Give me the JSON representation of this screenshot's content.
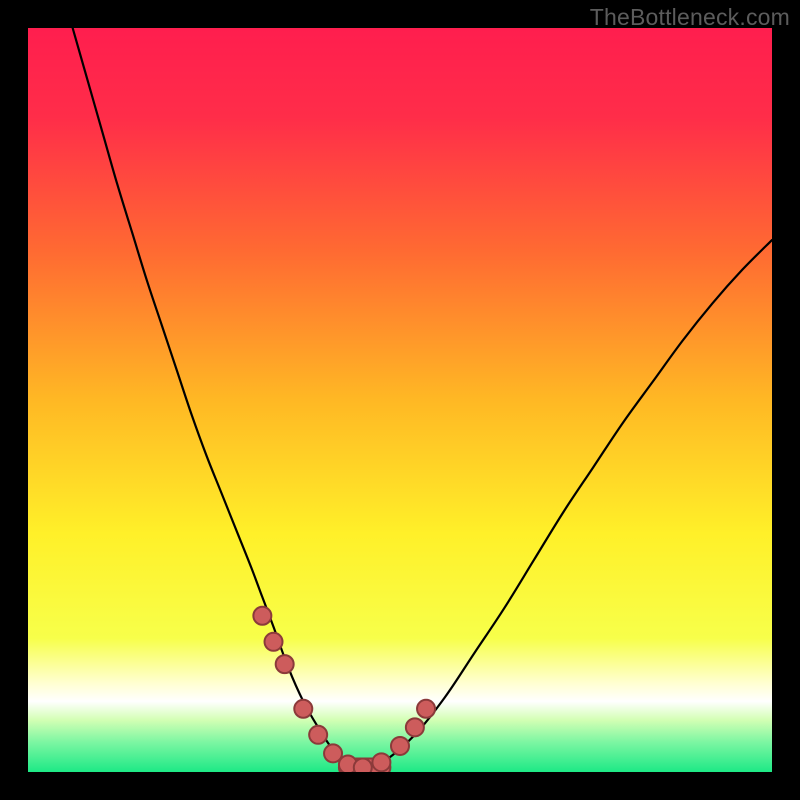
{
  "watermark": {
    "text": "TheBottleneck.com"
  },
  "chart_data": {
    "type": "line",
    "title": "",
    "xlabel": "",
    "ylabel": "",
    "xlim": [
      0,
      100
    ],
    "ylim": [
      0,
      100
    ],
    "grid": false,
    "legend": false,
    "gradient_stops": [
      {
        "offset": 0.0,
        "color": "#ff1e4e"
      },
      {
        "offset": 0.12,
        "color": "#ff2d49"
      },
      {
        "offset": 0.3,
        "color": "#ff6a32"
      },
      {
        "offset": 0.5,
        "color": "#ffb824"
      },
      {
        "offset": 0.68,
        "color": "#fff029"
      },
      {
        "offset": 0.82,
        "color": "#f7ff4a"
      },
      {
        "offset": 0.88,
        "color": "#ffffd0"
      },
      {
        "offset": 0.905,
        "color": "#ffffff"
      },
      {
        "offset": 0.93,
        "color": "#d3ffb4"
      },
      {
        "offset": 0.96,
        "color": "#7cf6a2"
      },
      {
        "offset": 1.0,
        "color": "#1de986"
      }
    ],
    "series": [
      {
        "name": "bottleneck-curve",
        "x": [
          6,
          8,
          10,
          12,
          14,
          16,
          18,
          20,
          22,
          24,
          26,
          28,
          30,
          31.5,
          33,
          35,
          37,
          39,
          41,
          43,
          44.5,
          46,
          48,
          52,
          56,
          60,
          64,
          68,
          72,
          76,
          80,
          84,
          88,
          92,
          96,
          100
        ],
        "y": [
          100,
          93,
          86,
          79,
          72.5,
          66,
          60,
          54,
          48,
          42.5,
          37.5,
          32.5,
          27.5,
          23.5,
          19.5,
          14,
          9.5,
          6,
          3,
          1.3,
          0.6,
          0.6,
          1.5,
          5,
          10,
          16,
          22,
          28.5,
          35,
          41,
          47,
          52.5,
          58,
          63,
          67.5,
          71.5
        ]
      },
      {
        "name": "marker-cluster",
        "x": [
          31.5,
          33.0,
          34.5,
          37.0,
          39.0,
          41.0,
          43.0,
          45.0,
          47.5,
          50.0,
          52.0,
          53.5
        ],
        "y": [
          21.0,
          17.5,
          14.5,
          8.5,
          5.0,
          2.5,
          1.0,
          0.6,
          1.3,
          3.5,
          6.0,
          8.5
        ]
      }
    ],
    "marker_style": {
      "fill": "#cd5c5c",
      "stroke": "#8b3a3a",
      "radius": 9
    },
    "trough_band": {
      "y": 0.6,
      "x_start": 43.0,
      "x_end": 47.5,
      "fill": "#cd5c5c",
      "stroke": "#8b3a3a",
      "half_height": 9
    }
  }
}
